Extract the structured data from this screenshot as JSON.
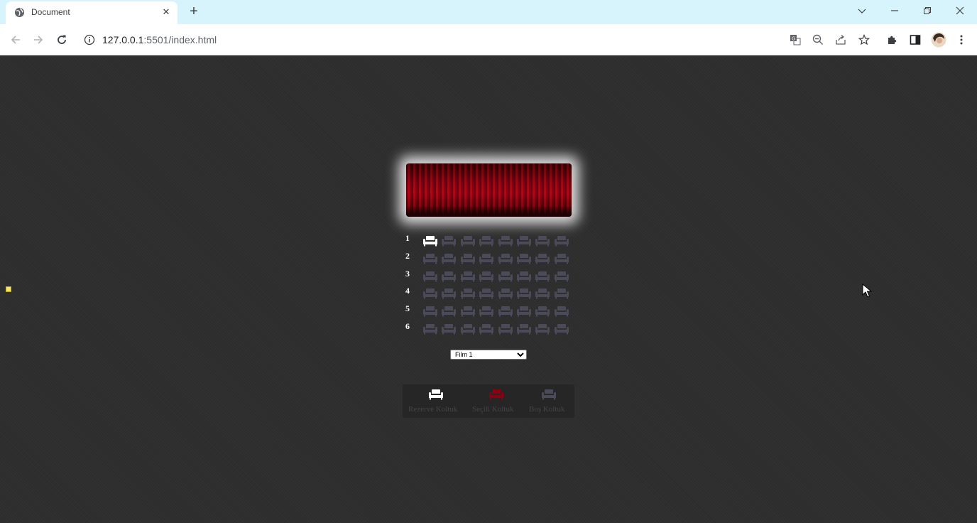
{
  "browser": {
    "tab_title": "Document",
    "url_host": "127.0.0.1",
    "url_rest": ":5501/index.html",
    "icons": [
      "globe-icon",
      "close-icon",
      "plus-icon",
      "chevron-down-icon",
      "minimize-icon",
      "restore-icon",
      "window-close-icon",
      "back-arrow-icon",
      "forward-arrow-icon",
      "reload-icon",
      "info-icon",
      "translate-icon",
      "zoom-out-icon",
      "share-icon",
      "star-icon",
      "puzzle-icon",
      "side-panel-icon",
      "profile-avatar",
      "menu-dots-icon"
    ]
  },
  "cinema": {
    "rows": [
      {
        "label": "1",
        "seats": [
          "reserved",
          "empty",
          "empty",
          "empty",
          "empty",
          "empty",
          "empty",
          "empty"
        ]
      },
      {
        "label": "2",
        "seats": [
          "empty",
          "empty",
          "empty",
          "empty",
          "empty",
          "empty",
          "empty",
          "empty"
        ]
      },
      {
        "label": "3",
        "seats": [
          "empty",
          "empty",
          "empty",
          "empty",
          "empty",
          "empty",
          "empty",
          "empty"
        ]
      },
      {
        "label": "4",
        "seats": [
          "empty",
          "empty",
          "empty",
          "empty",
          "empty",
          "empty",
          "empty",
          "empty"
        ]
      },
      {
        "label": "5",
        "seats": [
          "empty",
          "empty",
          "empty",
          "empty",
          "empty",
          "empty",
          "empty",
          "empty"
        ]
      },
      {
        "label": "6",
        "seats": [
          "empty",
          "empty",
          "empty",
          "empty",
          "empty",
          "empty",
          "empty",
          "empty"
        ]
      }
    ],
    "movie_select": {
      "selected": "Film 1"
    },
    "legend": [
      {
        "label": "Rezerve Koltuk",
        "state": "reserved"
      },
      {
        "label": "Seçili Koltuk",
        "state": "selected"
      },
      {
        "label": "Boş Koltuk",
        "state": "empty"
      }
    ]
  },
  "colors": {
    "reserved": "#ffffff",
    "selected": "#8b0010",
    "empty": "#4a4a58",
    "page_bg": "#2d2d2d",
    "tabstrip_bg": "#d7f3fb"
  }
}
